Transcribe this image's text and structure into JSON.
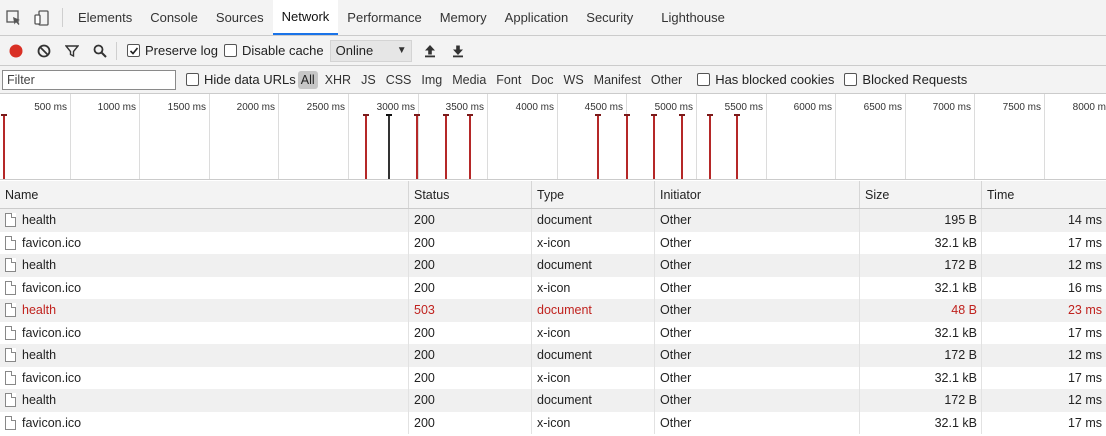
{
  "tabs": [
    {
      "label": "Elements",
      "name": "tab-elements"
    },
    {
      "label": "Console",
      "name": "tab-console"
    },
    {
      "label": "Sources",
      "name": "tab-sources"
    },
    {
      "label": "Network",
      "name": "tab-network",
      "active": true
    },
    {
      "label": "Performance",
      "name": "tab-performance"
    },
    {
      "label": "Memory",
      "name": "tab-memory"
    },
    {
      "label": "Application",
      "name": "tab-application"
    },
    {
      "label": "Security",
      "name": "tab-security"
    },
    {
      "label": "Lighthouse",
      "name": "tab-lighthouse"
    }
  ],
  "toolbar": {
    "preserve_log": {
      "label": "Preserve log",
      "checked": true
    },
    "disable_cache": {
      "label": "Disable cache",
      "checked": false
    },
    "throttling": "Online"
  },
  "filter": {
    "placeholder": "Filter",
    "hide_data_urls": "Hide data URLs",
    "types": [
      "All",
      "XHR",
      "JS",
      "CSS",
      "Img",
      "Media",
      "Font",
      "Doc",
      "WS",
      "Manifest",
      "Other"
    ],
    "active_type": "All",
    "has_blocked_cookies": "Has blocked cookies",
    "blocked_requests": "Blocked Requests"
  },
  "overview": {
    "ticks": [
      "500 ms",
      "1000 ms",
      "1500 ms",
      "2000 ms",
      "2500 ms",
      "3000 ms",
      "3500 ms",
      "4000 ms",
      "4500 ms",
      "5000 ms",
      "5500 ms",
      "6000 ms",
      "6500 ms",
      "7000 ms",
      "7500 ms",
      "8000 ms"
    ],
    "markers_ms": [
      {
        "t": 20,
        "kind": "red"
      },
      {
        "t": 2620,
        "kind": "red"
      },
      {
        "t": 2790,
        "kind": "dark"
      },
      {
        "t": 2990,
        "kind": "red"
      },
      {
        "t": 3200,
        "kind": "red"
      },
      {
        "t": 3370,
        "kind": "red"
      },
      {
        "t": 4290,
        "kind": "red"
      },
      {
        "t": 4500,
        "kind": "red"
      },
      {
        "t": 4690,
        "kind": "red"
      },
      {
        "t": 4890,
        "kind": "red"
      },
      {
        "t": 5090,
        "kind": "red"
      },
      {
        "t": 5290,
        "kind": "red"
      }
    ]
  },
  "colors": {
    "error": "#c0221e",
    "accent": "#1a73e8",
    "record": "#d93025"
  },
  "table": {
    "columns": [
      "Name",
      "Status",
      "Type",
      "Initiator",
      "Size",
      "Time"
    ],
    "rows": [
      {
        "name": "health",
        "status": "200",
        "type": "document",
        "initiator": "Other",
        "size": "195 B",
        "time": "14 ms"
      },
      {
        "name": "favicon.ico",
        "status": "200",
        "type": "x-icon",
        "initiator": "Other",
        "size": "32.1 kB",
        "time": "17 ms"
      },
      {
        "name": "health",
        "status": "200",
        "type": "document",
        "initiator": "Other",
        "size": "172 B",
        "time": "12 ms"
      },
      {
        "name": "favicon.ico",
        "status": "200",
        "type": "x-icon",
        "initiator": "Other",
        "size": "32.1 kB",
        "time": "16 ms"
      },
      {
        "name": "health",
        "status": "503",
        "type": "document",
        "initiator": "Other",
        "size": "48 B",
        "time": "23 ms",
        "error": true
      },
      {
        "name": "favicon.ico",
        "status": "200",
        "type": "x-icon",
        "initiator": "Other",
        "size": "32.1 kB",
        "time": "17 ms"
      },
      {
        "name": "health",
        "status": "200",
        "type": "document",
        "initiator": "Other",
        "size": "172 B",
        "time": "12 ms"
      },
      {
        "name": "favicon.ico",
        "status": "200",
        "type": "x-icon",
        "initiator": "Other",
        "size": "32.1 kB",
        "time": "17 ms"
      },
      {
        "name": "health",
        "status": "200",
        "type": "document",
        "initiator": "Other",
        "size": "172 B",
        "time": "12 ms"
      },
      {
        "name": "favicon.ico",
        "status": "200",
        "type": "x-icon",
        "initiator": "Other",
        "size": "32.1 kB",
        "time": "17 ms"
      }
    ]
  }
}
